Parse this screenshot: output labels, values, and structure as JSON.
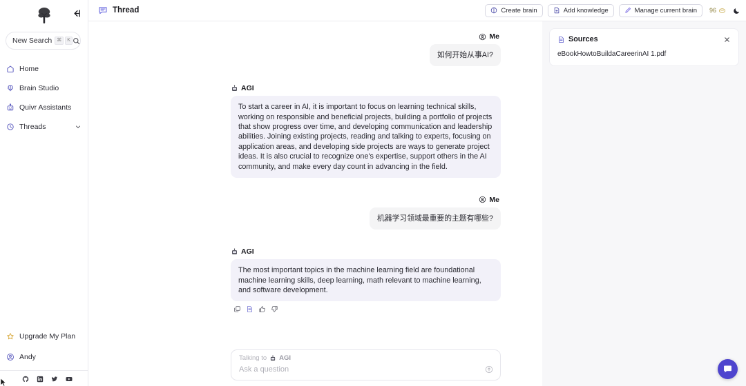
{
  "sidebar": {
    "logo_icon": "tree-logo-icon",
    "collapse_icon": "collapse-sidebar-icon",
    "search": {
      "label": "New Search",
      "keys": [
        "⌘",
        "K"
      ],
      "icon": "search-icon"
    },
    "items": [
      {
        "label": "Home",
        "icon": "home-icon"
      },
      {
        "label": "Brain Studio",
        "icon": "brain-icon"
      },
      {
        "label": "Quivr Assistants",
        "icon": "robot-icon"
      },
      {
        "label": "Threads",
        "icon": "history-clock-icon",
        "chevron": "chevron-down-icon"
      }
    ],
    "upgrade": {
      "label": "Upgrade My Plan",
      "icon": "star-icon"
    },
    "user": {
      "label": "Andy",
      "icon": "user-avatar-icon"
    },
    "social": [
      {
        "name": "github-icon"
      },
      {
        "name": "linkedin-icon"
      },
      {
        "name": "twitter-icon"
      },
      {
        "name": "youtube-icon"
      }
    ]
  },
  "topbar": {
    "title": "Thread",
    "title_icon": "thread-chat-icon",
    "buttons": [
      {
        "label": "Create brain",
        "icon": "create-brain-icon"
      },
      {
        "label": "Add knowledge",
        "icon": "add-knowledge-icon"
      },
      {
        "label": "Manage current brain",
        "icon": "pencil-icon"
      }
    ],
    "credits": {
      "value": "96",
      "icon": "credit-coin-icon"
    },
    "theme_toggle_icon": "moon-icon"
  },
  "chat": {
    "messages": [
      {
        "role": "Me",
        "role_icon": "user-avatar-icon",
        "text": "如何开始从事AI?"
      },
      {
        "role": "AGI",
        "role_icon": "agi-brain-icon",
        "text": "To start a career in AI, it is important to focus on learning technical skills, working on responsible and beneficial projects, building a portfolio of projects that show progress over time, and developing communication and leadership abilities. Joining existing projects, reading and talking to experts, focusing on application areas, and developing side projects are ways to generate project ideas. It is also crucial to recognize one's expertise, support others in the AI community, and make every day count in advancing in the field."
      },
      {
        "role": "Me",
        "role_icon": "user-avatar-icon",
        "text": "机器学习领域最重要的主题有哪些?"
      },
      {
        "role": "AGI",
        "role_icon": "agi-brain-icon",
        "text": "The most important topics in the machine learning field are foundational machine learning skills, deep learning, math relevant to machine learning, and software development."
      }
    ],
    "actions": [
      {
        "name": "copy-icon"
      },
      {
        "name": "sources-doc-icon"
      },
      {
        "name": "thumbs-up-icon"
      },
      {
        "name": "thumbs-down-icon"
      }
    ]
  },
  "composer": {
    "talking_to_prefix": "Talking to",
    "talking_to_name": "AGI",
    "talking_to_icon": "agi-brain-icon",
    "placeholder": "Ask a question",
    "value": "",
    "send_icon": "send-arrow-up-icon"
  },
  "sources": {
    "title": "Sources",
    "title_icon": "document-icon",
    "close_icon": "close-icon",
    "items": [
      "eBookHowtoBuildaCareerinAI 1.pdf"
    ]
  },
  "chat_widget": {
    "icon": "chat-bubble-icon"
  },
  "colors": {
    "accent": "#4e44ce",
    "agi_bubble": "#f2f1f9",
    "user_bubble": "#f4f4f5",
    "panel_bg": "#f7f7f9",
    "credits_text": "#8c7f3a"
  }
}
